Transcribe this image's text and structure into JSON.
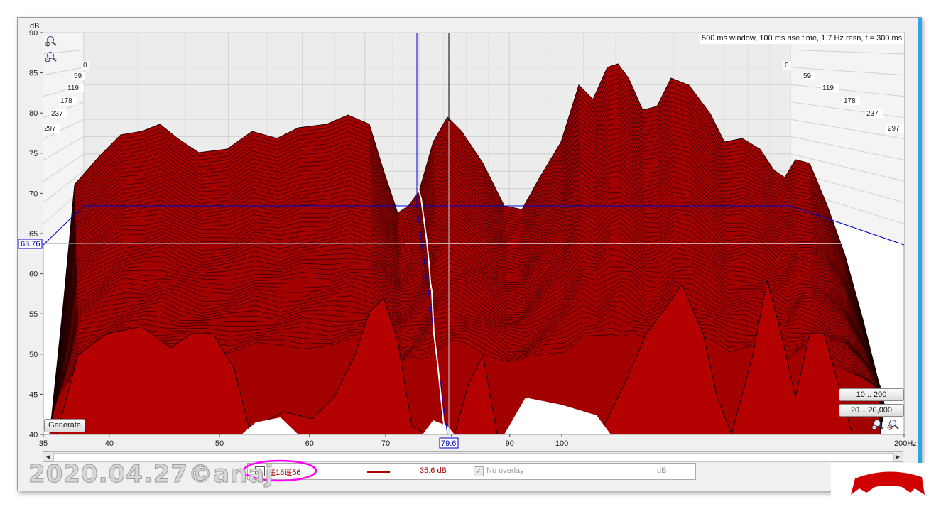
{
  "info_text": "500 ms window, 100 ms rise time,  1.7 Hz resn, t = 300 ms",
  "y_axis": {
    "unit": "dB",
    "ticks": [
      "90",
      "85",
      "80",
      "75",
      "70",
      "65",
      "60",
      "55",
      "50",
      "45",
      "40"
    ],
    "cursor_value": "63.76"
  },
  "x_axis": {
    "ticks": [
      "35",
      "40",
      "50",
      "60",
      "70",
      "80",
      "90",
      "100",
      "200Hz"
    ],
    "cursor_value": "79.6"
  },
  "time_labels_left": [
    "0",
    "59",
    "119",
    "178",
    "237",
    "297"
  ],
  "time_labels_right": [
    "0",
    "59",
    "119",
    "178",
    "237",
    "297"
  ],
  "buttons": {
    "generate": "Generate",
    "range_low": "10 .. 200",
    "range_full": "20 .. 20,000"
  },
  "legend": {
    "trace_name": "遥18遥56",
    "trace_value": "35.6 dB",
    "overlay_label": "No overlay",
    "overlay_unit": "dB",
    "trace_color": "#b00000"
  },
  "watermark": "2020.04.27©anaj",
  "colors": {
    "waterfall": "#b30000",
    "cursor": "#0000cc",
    "accent": "#2aa6e8",
    "highlight": "#ff00ff"
  },
  "icons": {
    "zoom_in": "zoom-in-icon",
    "zoom_out": "zoom-out-icon"
  }
}
